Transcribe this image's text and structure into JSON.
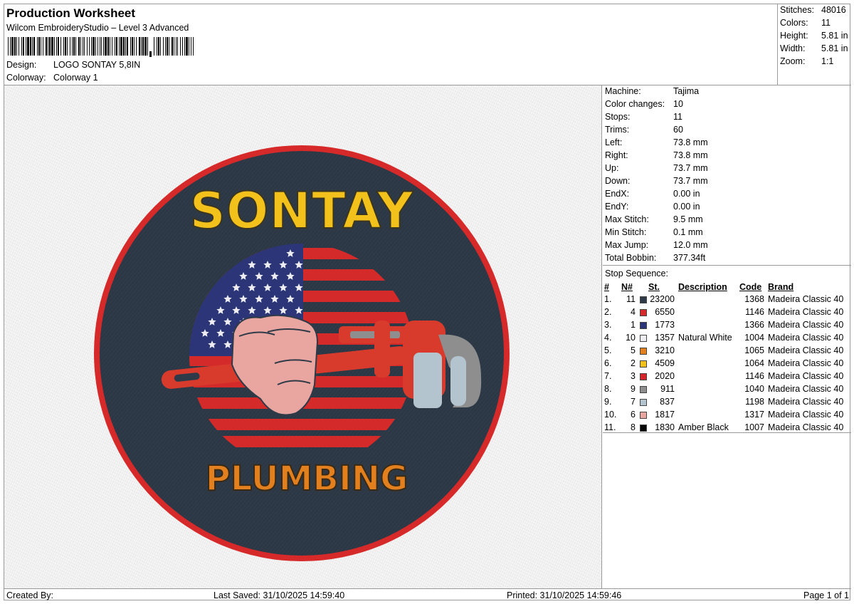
{
  "header": {
    "title": "Production Worksheet",
    "subtitle": "Wilcom EmbroideryStudio – Level 3 Advanced",
    "design_label": "Design:",
    "design_value": "LOGO SONTAY 5,8IN",
    "colorway_label": "Colorway:",
    "colorway_value": "Colorway 1"
  },
  "stats": [
    {
      "label": "Stitches:",
      "value": "48016"
    },
    {
      "label": "Colors:",
      "value": "11"
    },
    {
      "label": "Height:",
      "value": "5.81 in"
    },
    {
      "label": "Width:",
      "value": "5.81 in"
    },
    {
      "label": "Zoom:",
      "value": "1:1"
    }
  ],
  "machine_info": [
    {
      "label": "Machine:",
      "value": "Tajima"
    },
    {
      "label": "Color changes:",
      "value": "10"
    },
    {
      "label": "Stops:",
      "value": "11"
    },
    {
      "label": "Trims:",
      "value": "60"
    },
    {
      "label": "Left:",
      "value": "73.8 mm"
    },
    {
      "label": "Right:",
      "value": "73.8 mm"
    },
    {
      "label": "Up:",
      "value": "73.7 mm"
    },
    {
      "label": "Down:",
      "value": "73.7 mm"
    },
    {
      "label": "EndX:",
      "value": "0.00 in"
    },
    {
      "label": "EndY:",
      "value": "0.00 in"
    },
    {
      "label": "Max Stitch:",
      "value": "9.5 mm"
    },
    {
      "label": "Min Stitch:",
      "value": "0.1 mm"
    },
    {
      "label": "Max Jump:",
      "value": "12.0 mm"
    },
    {
      "label": "Total Bobbin:",
      "value": "377.34ft"
    }
  ],
  "stop_sequence": {
    "title": "Stop Sequence:",
    "columns": [
      "#",
      "N#",
      "St.",
      "Description",
      "Code",
      "Brand"
    ],
    "rows": [
      {
        "idx": "1.",
        "n": "11",
        "color": "#2e3a48",
        "st": "23200",
        "desc": "",
        "code": "1368",
        "brand": "Madeira Classic 40"
      },
      {
        "idx": "2.",
        "n": "4",
        "color": "#d42a2a",
        "st": "6550",
        "desc": "",
        "code": "1146",
        "brand": "Madeira Classic 40"
      },
      {
        "idx": "3.",
        "n": "1",
        "color": "#2c3577",
        "st": "1773",
        "desc": "",
        "code": "1366",
        "brand": "Madeira Classic 40"
      },
      {
        "idx": "4.",
        "n": "10",
        "color": "#eeeef2",
        "st": "1357",
        "desc": "Natural White",
        "code": "1004",
        "brand": "Madeira Classic 40"
      },
      {
        "idx": "5.",
        "n": "5",
        "color": "#e2801f",
        "st": "3210",
        "desc": "",
        "code": "1065",
        "brand": "Madeira Classic 40"
      },
      {
        "idx": "6.",
        "n": "2",
        "color": "#f2c11c",
        "st": "4509",
        "desc": "",
        "code": "1064",
        "brand": "Madeira Classic 40"
      },
      {
        "idx": "7.",
        "n": "3",
        "color": "#d4262a",
        "st": "2020",
        "desc": "",
        "code": "1146",
        "brand": "Madeira Classic 40"
      },
      {
        "idx": "8.",
        "n": "9",
        "color": "#8e8e8e",
        "st": "911",
        "desc": "",
        "code": "1040",
        "brand": "Madeira Classic 40"
      },
      {
        "idx": "9.",
        "n": "7",
        "color": "#b4c4cf",
        "st": "837",
        "desc": "",
        "code": "1198",
        "brand": "Madeira Classic 40"
      },
      {
        "idx": "10.",
        "n": "6",
        "color": "#e9a6a0",
        "st": "1817",
        "desc": "",
        "code": "1317",
        "brand": "Madeira Classic 40"
      },
      {
        "idx": "11.",
        "n": "8",
        "color": "#050505",
        "st": "1830",
        "desc": "Amber Black",
        "code": "1007",
        "brand": "Madeira Classic 40"
      }
    ]
  },
  "design_image": {
    "top_text": "SONTAY",
    "bottom_text": "PLUMBING"
  },
  "footer": {
    "created_by": "Created By:",
    "last_saved": "Last Saved: 31/10/2025 14:59:40",
    "printed": "Printed: 31/10/2025 14:59:46",
    "page": "Page 1 of 1"
  }
}
